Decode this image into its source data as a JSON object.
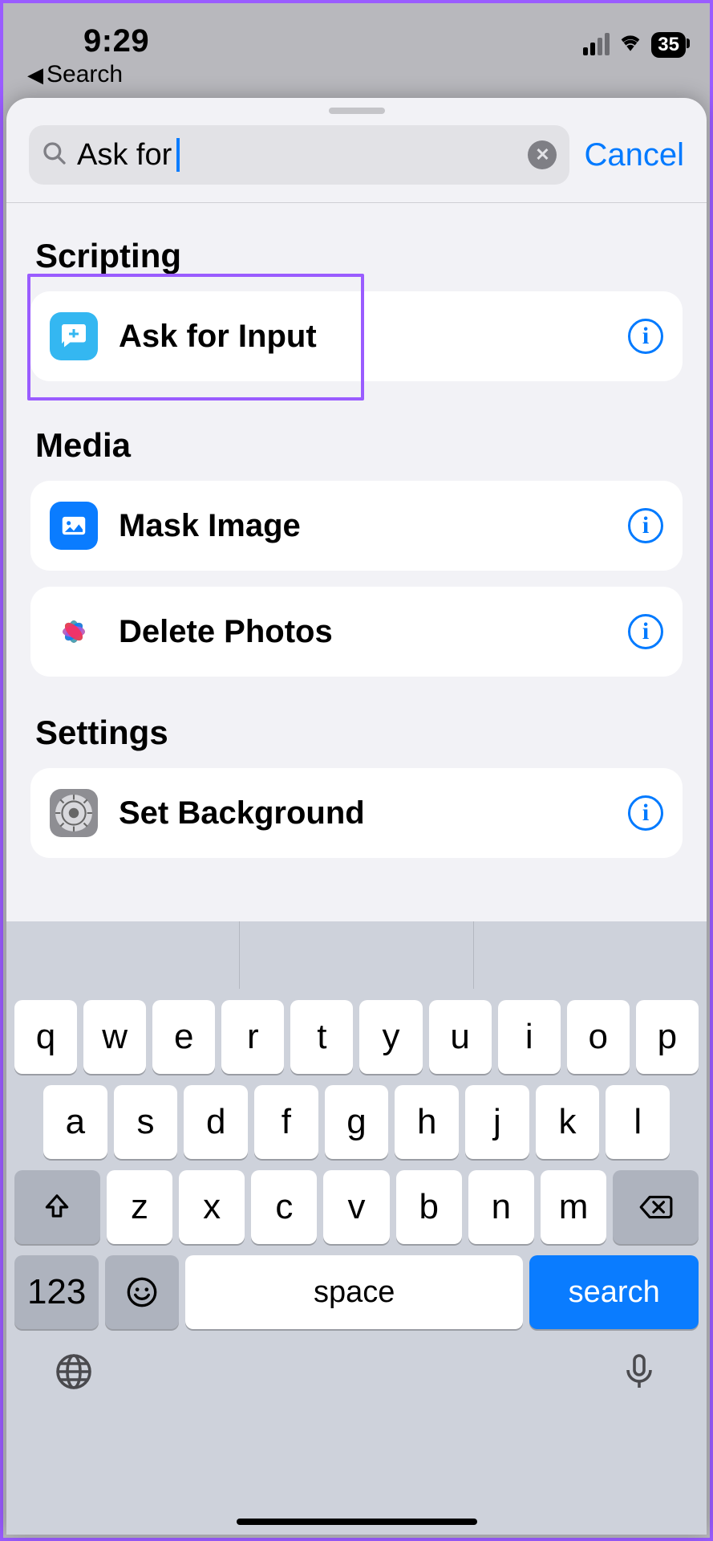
{
  "status": {
    "time": "9:29",
    "battery": "35"
  },
  "back": {
    "label": "Search"
  },
  "search": {
    "value": "Ask for",
    "cancel": "Cancel"
  },
  "sections": {
    "scripting": {
      "title": "Scripting",
      "item0": "Ask for Input"
    },
    "media": {
      "title": "Media",
      "item0": "Mask Image",
      "item1": "Delete Photos"
    },
    "settings": {
      "title": "Settings",
      "item0": "Set Background"
    }
  },
  "keyboard": {
    "row1": [
      "q",
      "w",
      "e",
      "r",
      "t",
      "y",
      "u",
      "i",
      "o",
      "p"
    ],
    "row2": [
      "a",
      "s",
      "d",
      "f",
      "g",
      "h",
      "j",
      "k",
      "l"
    ],
    "row3": [
      "z",
      "x",
      "c",
      "v",
      "b",
      "n",
      "m"
    ],
    "k123": "123",
    "space": "space",
    "search": "search"
  }
}
